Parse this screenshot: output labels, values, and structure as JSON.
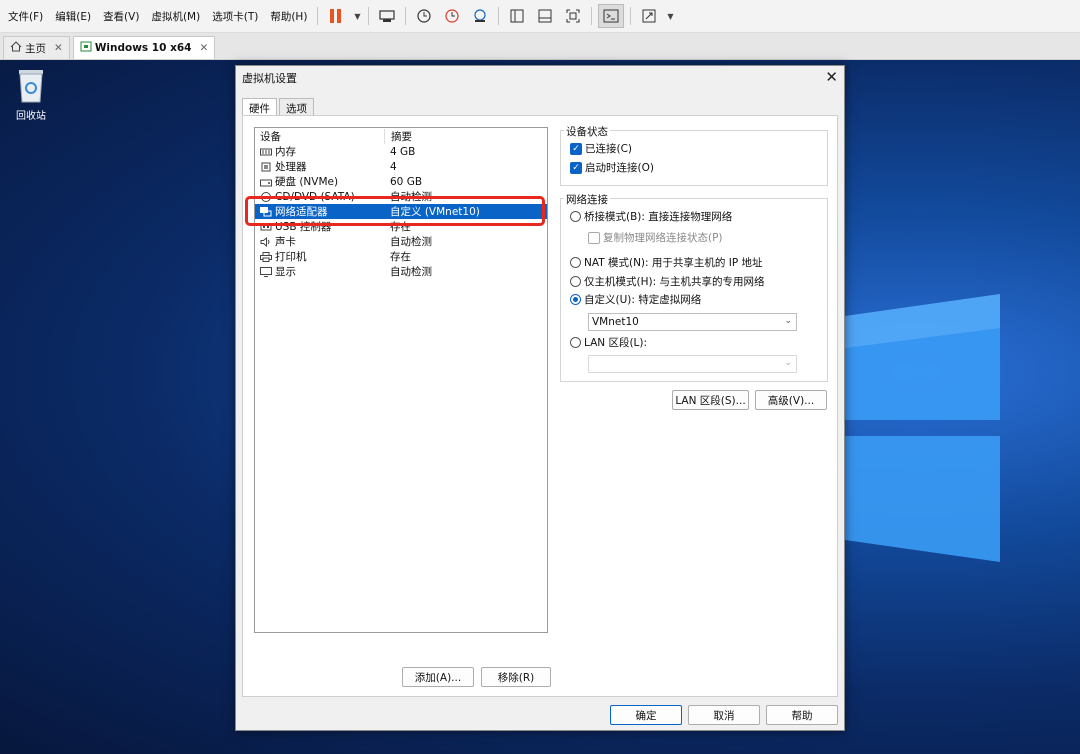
{
  "menubar": {
    "items": [
      "文件(F)",
      "编辑(E)",
      "查看(V)",
      "虚拟机(M)",
      "选项卡(T)",
      "帮助(H)"
    ]
  },
  "tabs": [
    {
      "label": "主页"
    },
    {
      "label": "Windows 10 x64"
    }
  ],
  "desktop": {
    "recycle_bin_label": "回收站"
  },
  "dialog": {
    "title": "虚拟机设置",
    "tabs": [
      "硬件",
      "选项"
    ],
    "device_list": {
      "header_device": "设备",
      "header_summary": "摘要",
      "rows": [
        {
          "name": "内存",
          "summary": "4 GB",
          "icon": "memory-icon"
        },
        {
          "name": "处理器",
          "summary": "4",
          "icon": "cpu-icon"
        },
        {
          "name": "硬盘 (NVMe)",
          "summary": "60 GB",
          "icon": "disk-icon"
        },
        {
          "name": "CD/DVD (SATA)",
          "summary": "自动检测",
          "icon": "cdrom-icon"
        },
        {
          "name": "网络适配器",
          "summary": "自定义 (VMnet10)",
          "icon": "network-icon",
          "selected": true
        },
        {
          "name": "USB 控制器",
          "summary": "存在",
          "icon": "usb-icon"
        },
        {
          "name": "声卡",
          "summary": "自动检测",
          "icon": "sound-icon"
        },
        {
          "name": "打印机",
          "summary": "存在",
          "icon": "printer-icon"
        },
        {
          "name": "显示",
          "summary": "自动检测",
          "icon": "display-icon"
        }
      ]
    },
    "add_button": "添加(A)...",
    "remove_button": "移除(R)",
    "device_status": {
      "title": "设备状态",
      "connected": "已连接(C)",
      "connect_on_power": "启动时连接(O)"
    },
    "network": {
      "title": "网络连接",
      "bridged": "桥接模式(B): 直接连接物理网络",
      "replicate": "复制物理网络连接状态(P)",
      "nat": "NAT 模式(N): 用于共享主机的 IP 地址",
      "host_only": "仅主机模式(H): 与主机共享的专用网络",
      "custom": "自定义(U): 特定虚拟网络",
      "custom_value": "VMnet10",
      "lan": "LAN 区段(L):",
      "lan_value": ""
    },
    "lan_segments_button": "LAN 区段(S)...",
    "advanced_button": "高级(V)...",
    "ok_button": "确定",
    "cancel_button": "取消",
    "help_button": "帮助"
  },
  "colors": {
    "accent": "#0a64c8",
    "highlight": "#e8281e"
  }
}
